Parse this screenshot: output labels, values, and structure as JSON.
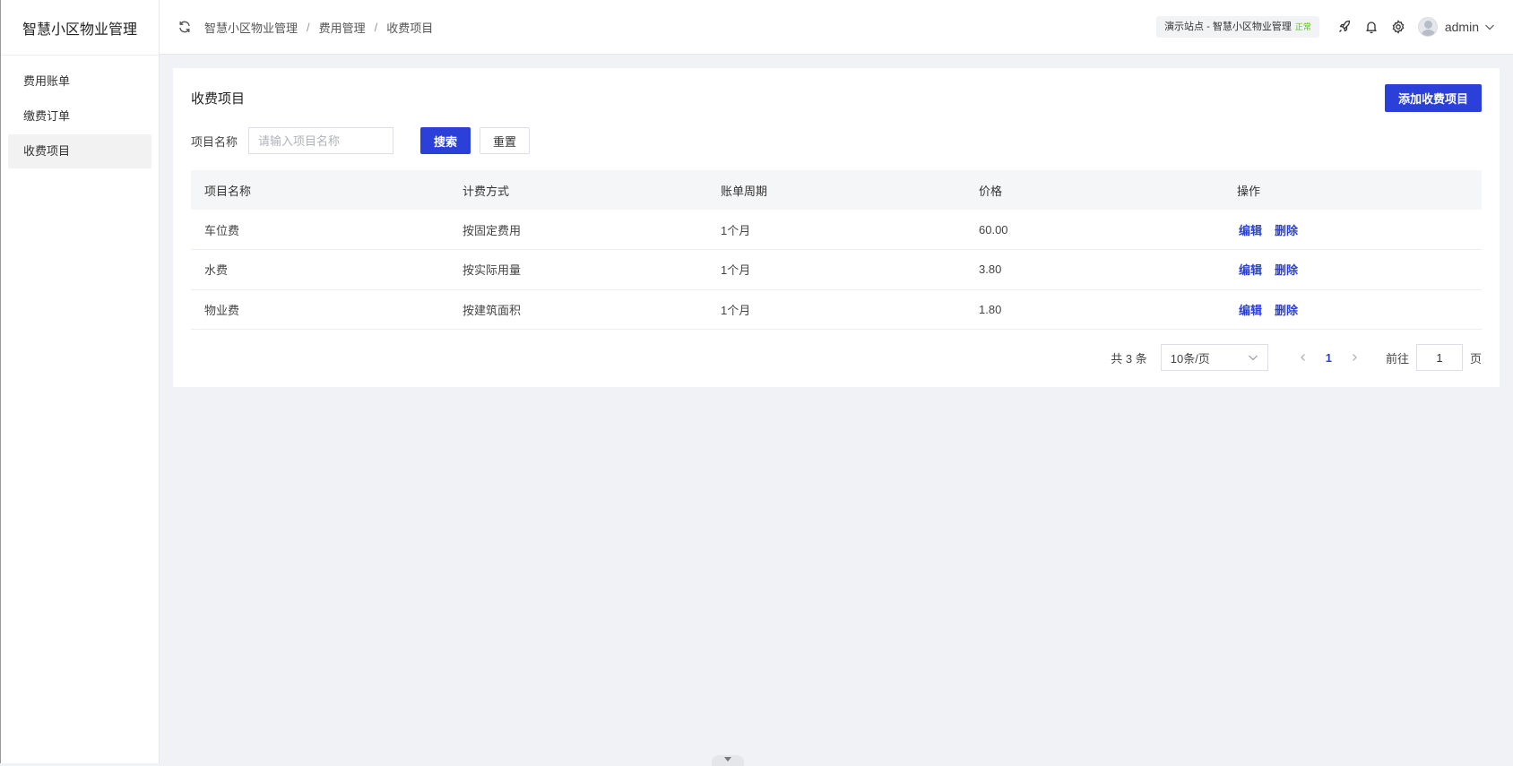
{
  "app": {
    "title": "智慧小区物业管理"
  },
  "sidebar": {
    "items": [
      {
        "label": "费用账单",
        "active": false
      },
      {
        "label": "缴费订单",
        "active": false
      },
      {
        "label": "收费项目",
        "active": true
      }
    ]
  },
  "header": {
    "breadcrumb": [
      "智慧小区物业管理",
      "费用管理",
      "收费项目"
    ],
    "site_tag": "演示站点 - 智慧小区物业管理",
    "site_status": "正常",
    "username": "admin",
    "icons": [
      "refresh-icon",
      "rocket-icon",
      "bell-icon",
      "gear-icon",
      "chevron-down-icon"
    ]
  },
  "main": {
    "title": "收费项目",
    "add_button": "添加收费项目",
    "search": {
      "label": "项目名称",
      "placeholder": "请输入项目名称",
      "value": "",
      "search_button": "搜索",
      "reset_button": "重置"
    },
    "table": {
      "headers": [
        "项目名称",
        "计费方式",
        "账单周期",
        "价格",
        "操作"
      ],
      "rows": [
        {
          "name": "车位费",
          "method": "按固定费用",
          "period": "1个月",
          "price": "60.00"
        },
        {
          "name": "水费",
          "method": "按实际用量",
          "period": "1个月",
          "price": "3.80"
        },
        {
          "name": "物业费",
          "method": "按建筑面积",
          "period": "1个月",
          "price": "1.80"
        }
      ],
      "actions": {
        "edit": "编辑",
        "delete": "删除"
      }
    },
    "pagination": {
      "total_text": "共 3 条",
      "page_size": "10条/页",
      "current_page": "1",
      "goto_label": "前往",
      "goto_value": "1",
      "page_suffix": "页"
    }
  },
  "colors": {
    "primary": "#2b40d8",
    "status_ok": "#52c41a",
    "background": "#f0f2f5"
  }
}
